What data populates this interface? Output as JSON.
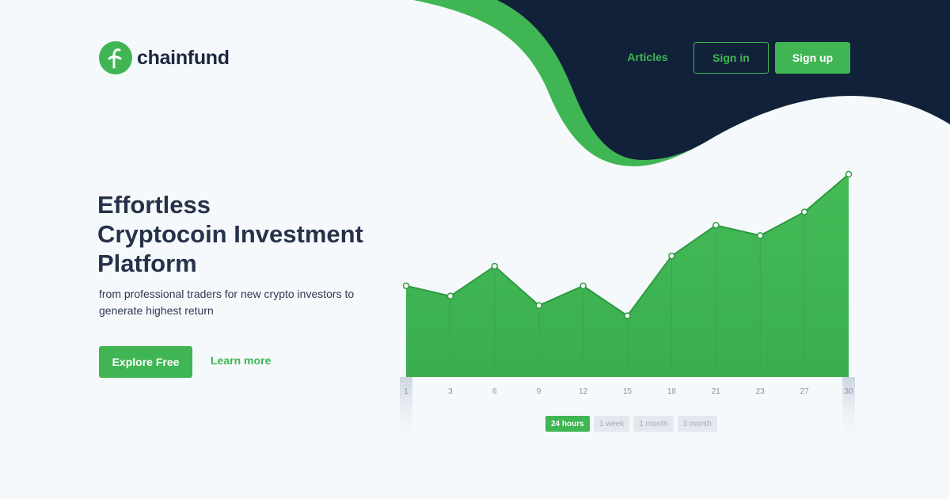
{
  "brand": {
    "name": "chainfund",
    "colors": {
      "primary": "#3fb653",
      "dark": "#12213a",
      "text": "#27324a",
      "background": "#f5f9fc"
    }
  },
  "nav": {
    "articles_label": "Articles",
    "signin_label": "Sign in",
    "signup_label": "Sign up"
  },
  "hero": {
    "title_lines": [
      "Effortless",
      "Cryptocoin Investment",
      "Platform"
    ],
    "subtitle_lines": [
      "from professional traders for new crypto investors to",
      "generate highest return"
    ],
    "cta_label": "Explore Free",
    "secondary_label": "Learn more"
  },
  "chart_data": {
    "type": "area",
    "title": "",
    "xlabel": "",
    "ylabel": "",
    "x": [
      "1",
      "3",
      "6",
      "9",
      "12",
      "15",
      "18",
      "21",
      "23",
      "27",
      "30"
    ],
    "series": [
      {
        "values": [
          116,
          103,
          141,
          91,
          116,
          78,
          154,
          193,
          180,
          210,
          258
        ]
      }
    ],
    "ylim": [
      0,
      260
    ],
    "grid": false,
    "color": "#3fb653"
  },
  "range_tabs": [
    {
      "label": "24 hours",
      "active": true
    },
    {
      "label": "1 week",
      "active": false
    },
    {
      "label": "1 month",
      "active": false
    },
    {
      "label": "3 month",
      "active": false
    }
  ]
}
